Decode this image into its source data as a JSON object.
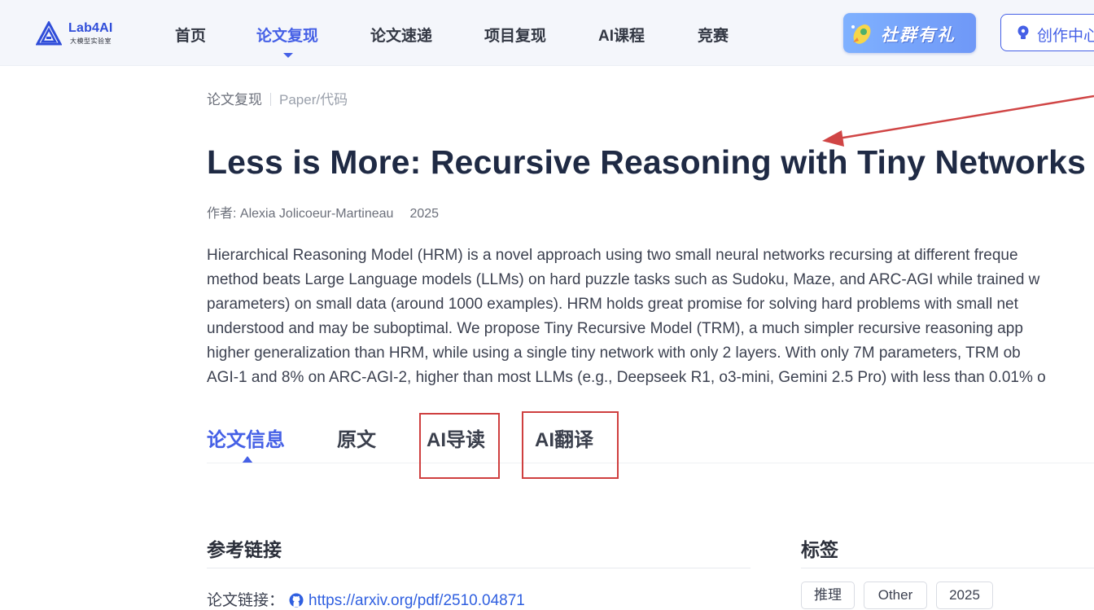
{
  "brand": {
    "name": "Lab4AI",
    "subtitle": "大模型实验室",
    "accent_color": "#4560e6"
  },
  "nav": {
    "items": [
      {
        "label": "首页",
        "active": false
      },
      {
        "label": "论文复现",
        "active": true
      },
      {
        "label": "论文速递",
        "active": false
      },
      {
        "label": "项目复现",
        "active": false
      },
      {
        "label": "AI课程",
        "active": false
      },
      {
        "label": "竞赛",
        "active": false
      }
    ],
    "community_label": "社群有礼",
    "community_icon": "gift-rocket-icon",
    "creator_label": "创作中心",
    "creator_icon": "lightbulb-icon"
  },
  "breadcrumb": {
    "parent": "论文复现",
    "current": "Paper/代码"
  },
  "paper": {
    "title": "Less is More: Recursive Reasoning with Tiny Networks",
    "author_label": "作者: Alexia Jolicoeur-Martineau",
    "year": "2025",
    "abstract_lines": [
      "Hierarchical Reasoning Model (HRM) is a novel approach using two small neural networks recursing at different freque",
      "method beats Large Language models (LLMs) on hard puzzle tasks such as Sudoku, Maze, and ARC-AGI while trained w",
      "parameters) on small data (around 1000 examples). HRM holds great promise for solving hard problems with small net",
      "understood and may be suboptimal. We propose Tiny Recursive Model (TRM), a much simpler recursive reasoning app",
      "higher generalization than HRM, while using a single tiny network with only 2 layers. With only 7M parameters, TRM ob",
      "AGI-1 and 8% on ARC-AGI-2, higher than most LLMs (e.g., Deepseek R1, o3-mini, Gemini 2.5 Pro) with less than 0.01% o"
    ]
  },
  "tabs": [
    {
      "label": "论文信息",
      "active": true
    },
    {
      "label": "原文",
      "active": false
    },
    {
      "label": "AI导读",
      "active": false,
      "highlighted": true
    },
    {
      "label": "AI翻译",
      "active": false,
      "highlighted": true
    }
  ],
  "references": {
    "title": "参考链接",
    "paper_link_label": "论文链接：",
    "paper_link_icon": "github-icon",
    "paper_link_url": "https://arxiv.org/pdf/2510.04871"
  },
  "tags_section": {
    "title": "标签",
    "tags": [
      "推理",
      "Other",
      "2025"
    ]
  },
  "annotation": {
    "color": "#cf3f3f"
  }
}
